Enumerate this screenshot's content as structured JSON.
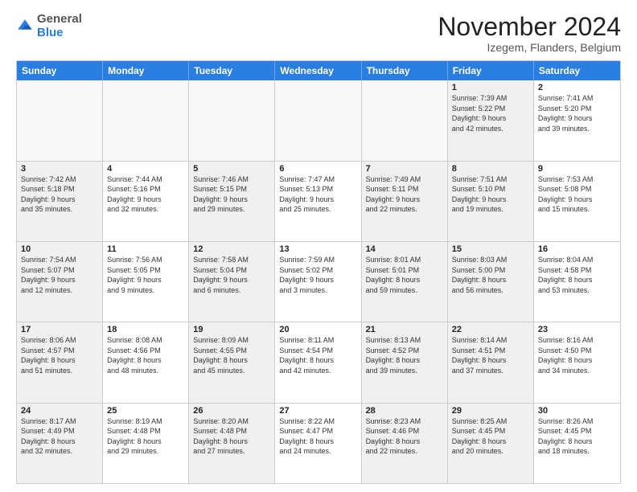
{
  "logo": {
    "line1": "General",
    "line2": "Blue"
  },
  "title": "November 2024",
  "subtitle": "Izegem, Flanders, Belgium",
  "header": {
    "days": [
      "Sunday",
      "Monday",
      "Tuesday",
      "Wednesday",
      "Thursday",
      "Friday",
      "Saturday"
    ]
  },
  "rows": [
    {
      "cells": [
        {
          "day": "",
          "info": "",
          "empty": true
        },
        {
          "day": "",
          "info": "",
          "empty": true
        },
        {
          "day": "",
          "info": "",
          "empty": true
        },
        {
          "day": "",
          "info": "",
          "empty": true
        },
        {
          "day": "",
          "info": "",
          "empty": true
        },
        {
          "day": "1",
          "info": "Sunrise: 7:39 AM\nSunset: 5:22 PM\nDaylight: 9 hours\nand 42 minutes.",
          "shaded": true
        },
        {
          "day": "2",
          "info": "Sunrise: 7:41 AM\nSunset: 5:20 PM\nDaylight: 9 hours\nand 39 minutes.",
          "shaded": false
        }
      ]
    },
    {
      "cells": [
        {
          "day": "3",
          "info": "Sunrise: 7:42 AM\nSunset: 5:18 PM\nDaylight: 9 hours\nand 35 minutes.",
          "shaded": true
        },
        {
          "day": "4",
          "info": "Sunrise: 7:44 AM\nSunset: 5:16 PM\nDaylight: 9 hours\nand 32 minutes.",
          "shaded": false
        },
        {
          "day": "5",
          "info": "Sunrise: 7:46 AM\nSunset: 5:15 PM\nDaylight: 9 hours\nand 29 minutes.",
          "shaded": true
        },
        {
          "day": "6",
          "info": "Sunrise: 7:47 AM\nSunset: 5:13 PM\nDaylight: 9 hours\nand 25 minutes.",
          "shaded": false
        },
        {
          "day": "7",
          "info": "Sunrise: 7:49 AM\nSunset: 5:11 PM\nDaylight: 9 hours\nand 22 minutes.",
          "shaded": true
        },
        {
          "day": "8",
          "info": "Sunrise: 7:51 AM\nSunset: 5:10 PM\nDaylight: 9 hours\nand 19 minutes.",
          "shaded": true
        },
        {
          "day": "9",
          "info": "Sunrise: 7:53 AM\nSunset: 5:08 PM\nDaylight: 9 hours\nand 15 minutes.",
          "shaded": false
        }
      ]
    },
    {
      "cells": [
        {
          "day": "10",
          "info": "Sunrise: 7:54 AM\nSunset: 5:07 PM\nDaylight: 9 hours\nand 12 minutes.",
          "shaded": true
        },
        {
          "day": "11",
          "info": "Sunrise: 7:56 AM\nSunset: 5:05 PM\nDaylight: 9 hours\nand 9 minutes.",
          "shaded": false
        },
        {
          "day": "12",
          "info": "Sunrise: 7:58 AM\nSunset: 5:04 PM\nDaylight: 9 hours\nand 6 minutes.",
          "shaded": true
        },
        {
          "day": "13",
          "info": "Sunrise: 7:59 AM\nSunset: 5:02 PM\nDaylight: 9 hours\nand 3 minutes.",
          "shaded": false
        },
        {
          "day": "14",
          "info": "Sunrise: 8:01 AM\nSunset: 5:01 PM\nDaylight: 8 hours\nand 59 minutes.",
          "shaded": true
        },
        {
          "day": "15",
          "info": "Sunrise: 8:03 AM\nSunset: 5:00 PM\nDaylight: 8 hours\nand 56 minutes.",
          "shaded": true
        },
        {
          "day": "16",
          "info": "Sunrise: 8:04 AM\nSunset: 4:58 PM\nDaylight: 8 hours\nand 53 minutes.",
          "shaded": false
        }
      ]
    },
    {
      "cells": [
        {
          "day": "17",
          "info": "Sunrise: 8:06 AM\nSunset: 4:57 PM\nDaylight: 8 hours\nand 51 minutes.",
          "shaded": true
        },
        {
          "day": "18",
          "info": "Sunrise: 8:08 AM\nSunset: 4:56 PM\nDaylight: 8 hours\nand 48 minutes.",
          "shaded": false
        },
        {
          "day": "19",
          "info": "Sunrise: 8:09 AM\nSunset: 4:55 PM\nDaylight: 8 hours\nand 45 minutes.",
          "shaded": true
        },
        {
          "day": "20",
          "info": "Sunrise: 8:11 AM\nSunset: 4:54 PM\nDaylight: 8 hours\nand 42 minutes.",
          "shaded": false
        },
        {
          "day": "21",
          "info": "Sunrise: 8:13 AM\nSunset: 4:52 PM\nDaylight: 8 hours\nand 39 minutes.",
          "shaded": true
        },
        {
          "day": "22",
          "info": "Sunrise: 8:14 AM\nSunset: 4:51 PM\nDaylight: 8 hours\nand 37 minutes.",
          "shaded": true
        },
        {
          "day": "23",
          "info": "Sunrise: 8:16 AM\nSunset: 4:50 PM\nDaylight: 8 hours\nand 34 minutes.",
          "shaded": false
        }
      ]
    },
    {
      "cells": [
        {
          "day": "24",
          "info": "Sunrise: 8:17 AM\nSunset: 4:49 PM\nDaylight: 8 hours\nand 32 minutes.",
          "shaded": true
        },
        {
          "day": "25",
          "info": "Sunrise: 8:19 AM\nSunset: 4:48 PM\nDaylight: 8 hours\nand 29 minutes.",
          "shaded": false
        },
        {
          "day": "26",
          "info": "Sunrise: 8:20 AM\nSunset: 4:48 PM\nDaylight: 8 hours\nand 27 minutes.",
          "shaded": true
        },
        {
          "day": "27",
          "info": "Sunrise: 8:22 AM\nSunset: 4:47 PM\nDaylight: 8 hours\nand 24 minutes.",
          "shaded": false
        },
        {
          "day": "28",
          "info": "Sunrise: 8:23 AM\nSunset: 4:46 PM\nDaylight: 8 hours\nand 22 minutes.",
          "shaded": true
        },
        {
          "day": "29",
          "info": "Sunrise: 8:25 AM\nSunset: 4:45 PM\nDaylight: 8 hours\nand 20 minutes.",
          "shaded": true
        },
        {
          "day": "30",
          "info": "Sunrise: 8:26 AM\nSunset: 4:45 PM\nDaylight: 8 hours\nand 18 minutes.",
          "shaded": false
        }
      ]
    }
  ]
}
